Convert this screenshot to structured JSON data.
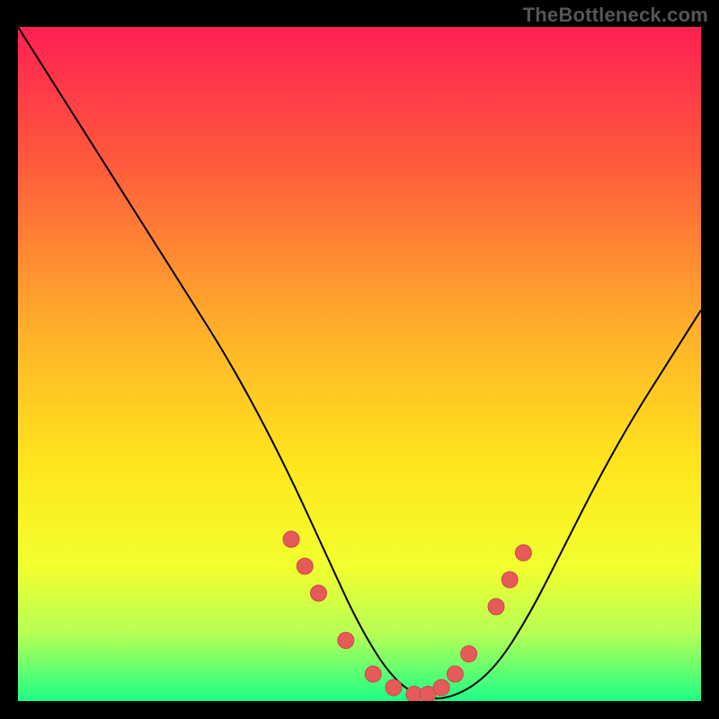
{
  "attribution": "TheBottleneck.com",
  "colors": {
    "gradient": [
      "#ff1f53",
      "#ff5a3c",
      "#ffb02a",
      "#ffe61c",
      "#f2ff2e",
      "#b6ff55",
      "#1dff86"
    ],
    "curve_stroke": "#000000",
    "marker_fill": "#e65a5a",
    "marker_stroke": "#c94a4a"
  },
  "chart_data": {
    "type": "line",
    "title": "",
    "xlabel": "",
    "ylabel": "",
    "xlim": [
      0,
      100
    ],
    "ylim": [
      0,
      100
    ],
    "x": [
      0,
      5,
      10,
      15,
      20,
      25,
      30,
      35,
      40,
      45,
      50,
      55,
      60,
      65,
      70,
      75,
      80,
      85,
      90,
      95,
      100
    ],
    "y": [
      100,
      92,
      84,
      76,
      68,
      60,
      52,
      43,
      33,
      22,
      11,
      3,
      0,
      1,
      5,
      13,
      23,
      33,
      42,
      50,
      58
    ],
    "markers_x": [
      40,
      42,
      44,
      48,
      52,
      55,
      58,
      60,
      62,
      64,
      66,
      70,
      72,
      74
    ],
    "markers_y": [
      24,
      20,
      16,
      9,
      4,
      2,
      1,
      1,
      2,
      4,
      7,
      14,
      18,
      22
    ],
    "annotations": []
  }
}
